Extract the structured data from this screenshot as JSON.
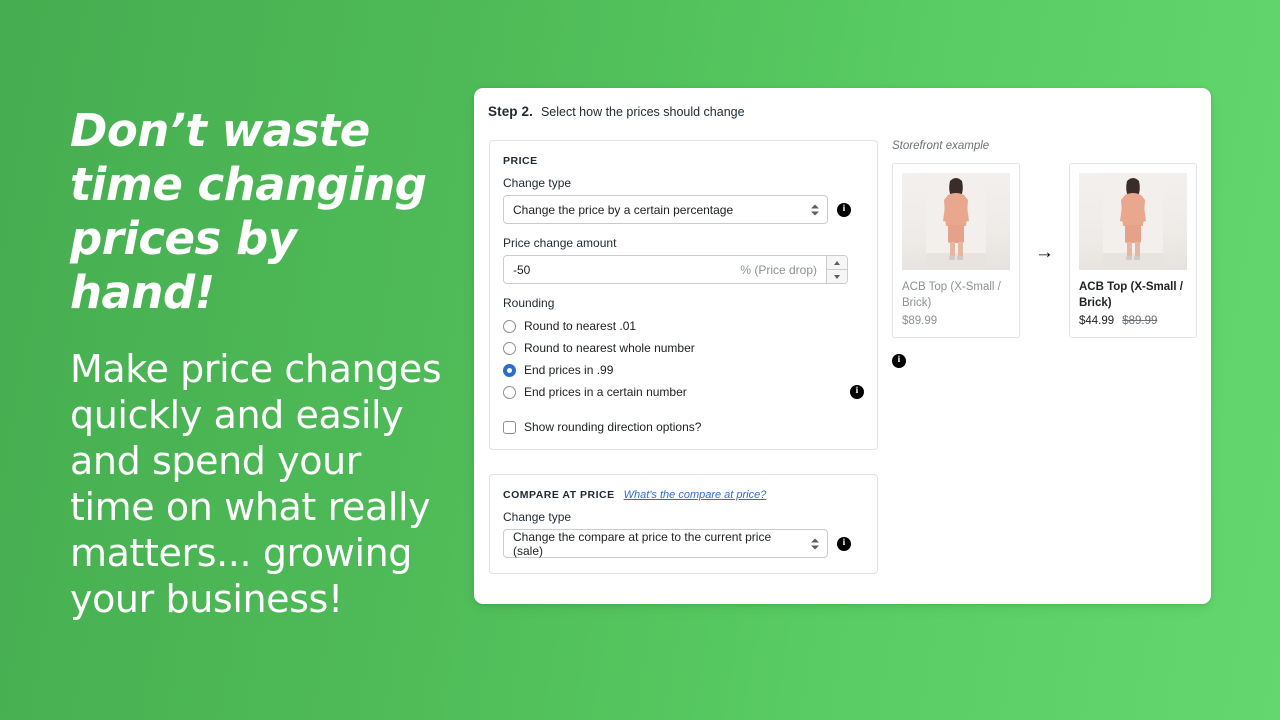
{
  "promo": {
    "headline": "Don’t waste time changing prices by hand!",
    "body": "Make price changes quickly and easily and spend your time on what really matters... growing your business!"
  },
  "app": {
    "step_label": "Step 2.",
    "step_description": "Select how the prices should change",
    "price_panel": {
      "title": "PRICE",
      "change_type_label": "Change type",
      "change_type_value": "Change the price by a certain percentage",
      "amount_label": "Price change amount",
      "amount_value": "-50",
      "amount_suffix": "% (Price drop)",
      "rounding_label": "Rounding",
      "rounding_options": [
        {
          "label": "Round to nearest .01",
          "selected": false
        },
        {
          "label": "Round to nearest whole number",
          "selected": false
        },
        {
          "label": "End prices in .99",
          "selected": true
        },
        {
          "label": "End prices in a certain number",
          "selected": false
        }
      ],
      "show_rounding_direction_label": "Show rounding direction options?",
      "show_rounding_direction_checked": false,
      "info_icon": "info-icon"
    },
    "compare_panel": {
      "title": "COMPARE AT PRICE",
      "help_link": "What's the compare at price?",
      "change_type_label": "Change type",
      "change_type_value": "Change the compare at price to the current price (sale)",
      "info_icon": "info-icon"
    },
    "preview": {
      "title": "Storefront example",
      "arrow": "→",
      "before": {
        "product_title": "ACB Top (X-Small / Brick)",
        "price": "$89.99"
      },
      "after": {
        "product_title": "ACB Top (X-Small / Brick)",
        "price_new": "$44.99",
        "price_old": "$89.99"
      },
      "info_icon": "info-icon"
    }
  },
  "colors": {
    "background_start": "#46ad50",
    "background_end": "#64d76e",
    "accent_blue": "#2c6ecb",
    "text_dark": "#202223",
    "text_muted": "#8c9196",
    "border": "#c9cccf"
  }
}
